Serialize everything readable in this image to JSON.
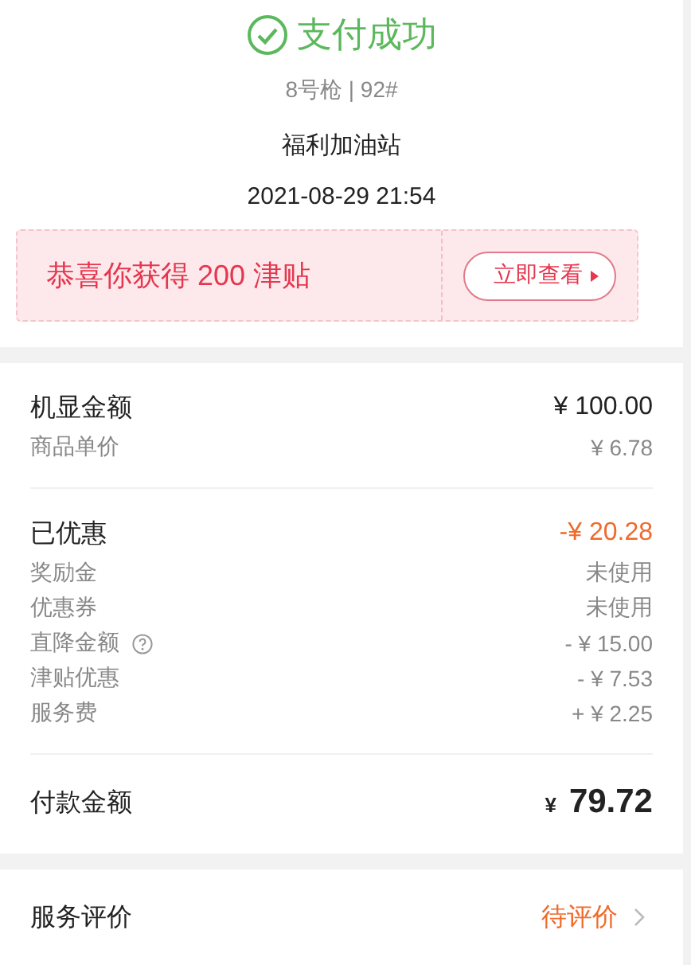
{
  "header": {
    "title": "支付成功",
    "pump": "8号枪 | 92#",
    "station": "福利加油站",
    "time": "2021-08-29 21:54"
  },
  "reward": {
    "message": "恭喜你获得 200 津贴",
    "button": "立即查看"
  },
  "groups": [
    {
      "rows": [
        {
          "kind": "main",
          "label": "机显金额",
          "value": "¥ 100.00",
          "help": false,
          "highlight": false
        },
        {
          "kind": "sub",
          "label": "商品单价",
          "value": "¥ 6.78",
          "help": false,
          "highlight": false
        }
      ]
    },
    {
      "rows": [
        {
          "kind": "main",
          "label": "已优惠",
          "value": "-¥ 20.28",
          "help": false,
          "highlight": true
        },
        {
          "kind": "sub",
          "label": "奖励金",
          "value": "未使用",
          "help": false,
          "highlight": false
        },
        {
          "kind": "sub",
          "label": "优惠券",
          "value": "未使用",
          "help": false,
          "highlight": false
        },
        {
          "kind": "sub",
          "label": "直降金额",
          "value": "- ¥ 15.00",
          "help": true,
          "highlight": false
        },
        {
          "kind": "sub",
          "label": "津贴优惠",
          "value": "- ¥ 7.53",
          "help": false,
          "highlight": false
        },
        {
          "kind": "sub",
          "label": "服务费",
          "value": "+ ¥ 2.25",
          "help": false,
          "highlight": false
        }
      ]
    }
  ],
  "total": {
    "label": "付款金额",
    "currency": "¥",
    "amount": "79.72"
  },
  "review": {
    "label": "服务评价",
    "status": "待评价"
  }
}
